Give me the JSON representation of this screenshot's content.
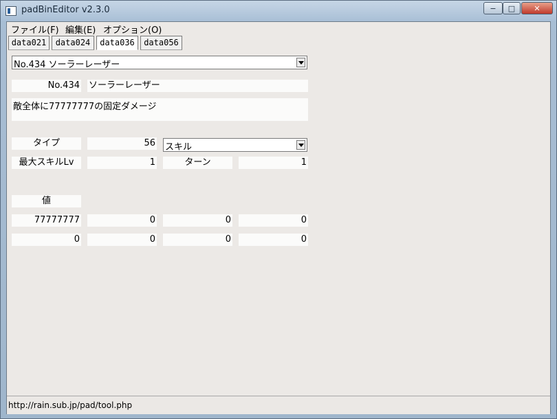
{
  "window": {
    "title": "padBinEditor v2.3.0",
    "controls": {
      "minimize": "−",
      "maximize": "□",
      "close": "✕"
    }
  },
  "menubar": {
    "items": [
      {
        "label": "ファイル(F)"
      },
      {
        "label": "編集(E)"
      },
      {
        "label": "オプション(O)"
      }
    ]
  },
  "tabs": [
    {
      "label": "data021"
    },
    {
      "label": "data024"
    },
    {
      "label": "data036",
      "active": true
    },
    {
      "label": "data056"
    }
  ],
  "skill_selector": {
    "value": "No.434 ソーラーレーザー"
  },
  "skill_id_label": "No.434",
  "skill_name": "ソーラーレーザー",
  "description": "敵全体に77777777の固定ダメージ",
  "type": {
    "label": "タイプ",
    "value": "56",
    "category": "スキル"
  },
  "max_skill_level": {
    "label": "最大スキルLv",
    "value": "1"
  },
  "turn": {
    "label": "ターン",
    "value": "1"
  },
  "values_section": {
    "label": "値",
    "row1": [
      "77777777",
      "0",
      "0",
      "0"
    ],
    "row2": [
      "0",
      "0",
      "0",
      "0"
    ]
  },
  "statusbar": {
    "text": "http://rain.sub.jp/pad/tool.php"
  }
}
